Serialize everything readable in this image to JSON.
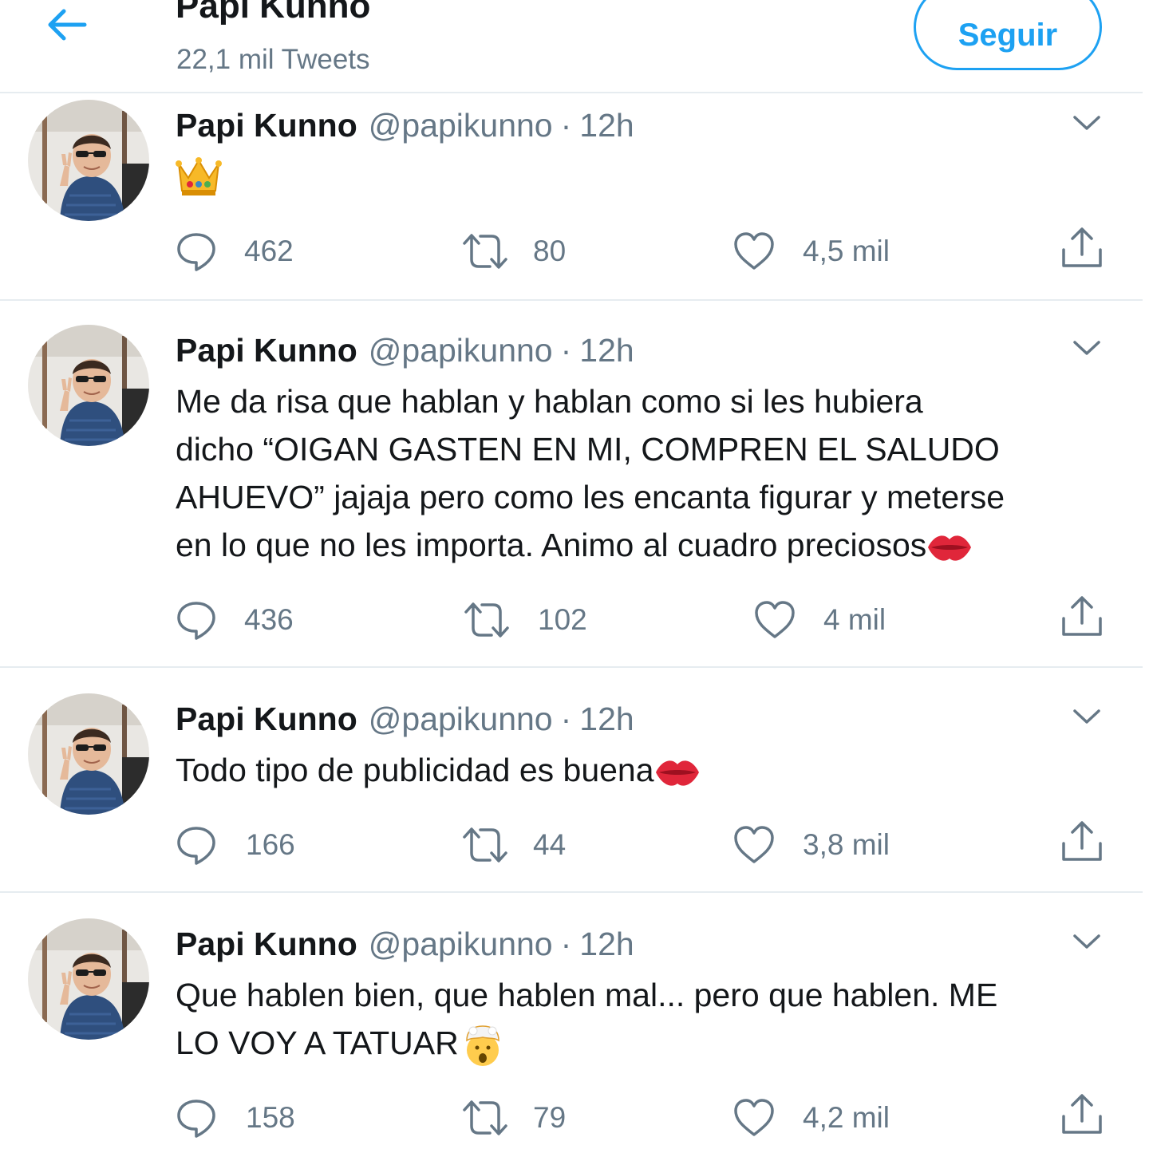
{
  "header": {
    "title": "Papi Kunno",
    "tweet_count": "22,1 mil Tweets",
    "follow_label": "Seguir",
    "back_icon": "arrow-left-icon"
  },
  "colors": {
    "accent": "#1da1f2",
    "text": "#14171a",
    "secondary": "#657786",
    "divider": "#e6ecf0",
    "kiss": "#e0263a"
  },
  "tweets": [
    {
      "name": "Papi Kunno",
      "handle": "@papikunno",
      "dot": "·",
      "time": "12h",
      "lines": [],
      "emoji": "crown",
      "replies": "462",
      "retweets": "80",
      "likes": "4,5 mil"
    },
    {
      "name": "Papi Kunno",
      "handle": "@papikunno",
      "dot": "·",
      "time": "12h",
      "lines": [
        "Me da risa que hablan y hablan como si les hubiera",
        "dicho “OIGAN GASTEN EN MI, COMPREN EL SALUDO",
        "AHUEVO” jajaja pero como les encanta figurar y meterse",
        "en lo que no les importa. Animo al cuadro preciosos"
      ],
      "emoji": "kiss-mark",
      "replies": "436",
      "retweets": "102",
      "likes": "4 mil"
    },
    {
      "name": "Papi Kunno",
      "handle": "@papikunno",
      "dot": "·",
      "time": "12h",
      "lines": [
        "Todo tipo de publicidad es buena"
      ],
      "emoji": "kiss-mark",
      "replies": "166",
      "retweets": "44",
      "likes": "3,8 mil"
    },
    {
      "name": "Papi Kunno",
      "handle": "@papikunno",
      "dot": "·",
      "time": "12h",
      "lines": [
        "Que hablen bien, que hablen mal... pero que hablen. ME",
        "LO VOY A TATUAR"
      ],
      "emoji": "exploding-head",
      "replies": "158",
      "retweets": "79",
      "likes": "4,2 mil"
    }
  ]
}
